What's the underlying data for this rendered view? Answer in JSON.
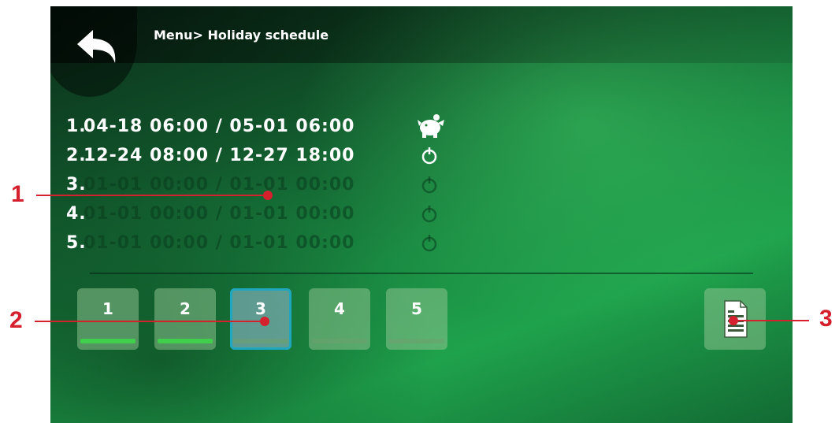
{
  "header": {
    "breadcrumb": "Menu> Holiday schedule"
  },
  "schedule": {
    "rows": [
      {
        "index": "1.",
        "text": "04-18 06:00 / 05-01 06:00",
        "state": "active",
        "icon": "piggy-bank-icon"
      },
      {
        "index": "2.",
        "text": "12-24 08:00 / 12-27 18:00",
        "state": "active",
        "icon": "power-icon"
      },
      {
        "index": "3.",
        "text": "01-01 00:00 / 01-01 00:00",
        "state": "inactive",
        "icon": "power-icon"
      },
      {
        "index": "4.",
        "text": "01-01 00:00 / 01-01 00:00",
        "state": "inactive",
        "icon": "power-icon"
      },
      {
        "index": "5.",
        "text": "01-01 00:00 / 01-01 00:00",
        "state": "inactive",
        "icon": "power-icon"
      }
    ]
  },
  "tabs": [
    {
      "label": "1",
      "enabled": true,
      "selected": false
    },
    {
      "label": "2",
      "enabled": true,
      "selected": false
    },
    {
      "label": "3",
      "enabled": false,
      "selected": true
    },
    {
      "label": "4",
      "enabled": false,
      "selected": false
    },
    {
      "label": "5",
      "enabled": false,
      "selected": false
    }
  ],
  "callouts": [
    "1",
    "2",
    "3"
  ],
  "colors": {
    "accent_green": "#3fcf4c",
    "selection_outline": "#1fa7c0",
    "callout_red": "#d5202e"
  }
}
